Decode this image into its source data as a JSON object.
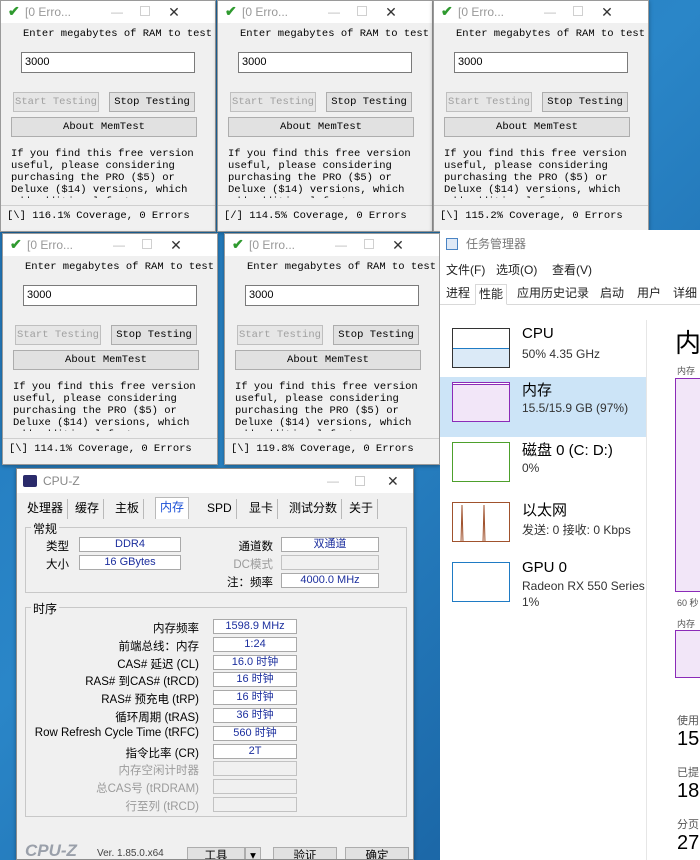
{
  "memtest": {
    "title": "[0 Erro...",
    "prompt": "Enter megabytes of RAM to test",
    "ram_value": "3000",
    "start_label": "Start Testing",
    "stop_label": "Stop Testing",
    "about_label": "About MemTest",
    "info_text": "If you find this free version useful, please considering purchasing the PRO ($5) or Deluxe ($14) versions, which add additional features",
    "statuses": [
      "[\\]  116.1% Coverage, 0 Errors",
      "[/]  114.5% Coverage, 0 Errors",
      "[\\]  115.2% Coverage, 0 Errors",
      "[\\]  114.1% Coverage, 0 Errors",
      "[\\]  119.8% Coverage, 0 Errors"
    ]
  },
  "taskmgr": {
    "title": "任务管理器",
    "menu": [
      "文件(F)",
      "选项(O)",
      "查看(V)"
    ],
    "tabs": [
      "进程",
      "性能",
      "应用历史记录",
      "启动",
      "用户",
      "详细"
    ],
    "active_tab": "性能",
    "items": [
      {
        "name": "CPU",
        "sub": "50% 4.35 GHz",
        "sub2": ""
      },
      {
        "name": "内存",
        "sub": "15.5/15.9 GB (97%)",
        "sub2": ""
      },
      {
        "name": "磁盘 0 (C: D:)",
        "sub": "0%",
        "sub2": ""
      },
      {
        "name": "以太网",
        "sub": "发送: 0 接收: 0 Kbps",
        "sub2": ""
      },
      {
        "name": "GPU 0",
        "sub": "Radeon RX 550 Series",
        "sub2": "1%"
      }
    ],
    "right": {
      "big": "内",
      "cap1": "内存使",
      "cap2": "60 秒",
      "cap3": "内存组",
      "k1": "使用",
      "v1": "15",
      "k2": "已提",
      "v2": "18",
      "k3": "分页",
      "v3": "27"
    },
    "colors": {
      "cpu": "#1f7bc4",
      "mem": "#8b2bb8",
      "disk": "#4da02c",
      "eth": "#a0522d",
      "gpu": "#1f7bc4"
    },
    "cpu_fraction": 0.5,
    "mem_fraction": 0.97
  },
  "cpuz": {
    "title": "CPU-Z",
    "tabs": [
      "处理器",
      "缓存",
      "主板",
      "内存",
      "SPD",
      "显卡",
      "测试分数",
      "关于"
    ],
    "active_tab": "内存",
    "general": {
      "label": "常规",
      "type_k": "类型",
      "type_v": "DDR4",
      "size_k": "大小",
      "size_v": "16 GBytes",
      "ch_k": "通道数",
      "ch_v": "双通道",
      "dc_k": "DC模式",
      "dc_v": "",
      "nb_k": "注：频率",
      "nb_v": "4000.0 MHz"
    },
    "timings": {
      "label": "时序",
      "rows": [
        {
          "k": "内存频率",
          "v": "1598.9 MHz",
          "dim": false
        },
        {
          "k": "前端总线：内存",
          "v": "1:24",
          "dim": false
        },
        {
          "k": "CAS# 延迟 (CL)",
          "v": "16.0 时钟",
          "dim": false
        },
        {
          "k": "RAS# 到CAS# (tRCD)",
          "v": "16 时钟",
          "dim": false
        },
        {
          "k": "RAS# 预充电 (tRP)",
          "v": "16 时钟",
          "dim": false
        },
        {
          "k": "循环周期 (tRAS)",
          "v": "36 时钟",
          "dim": false
        },
        {
          "k": "Row Refresh Cycle Time (tRFC)",
          "v": "560 时钟",
          "dim": false
        },
        {
          "k": "指令比率 (CR)",
          "v": "2T",
          "dim": false
        },
        {
          "k": "内存空闲计时器",
          "v": "",
          "dim": true
        },
        {
          "k": "总CAS号 (tRDRAM)",
          "v": "",
          "dim": true
        },
        {
          "k": "行至列 (tRCD)",
          "v": "",
          "dim": true
        }
      ]
    },
    "footer": {
      "logo": "CPU-Z",
      "version": "Ver. 1.85.0.x64",
      "tools": "工具",
      "validate": "验证",
      "ok": "确定"
    }
  }
}
